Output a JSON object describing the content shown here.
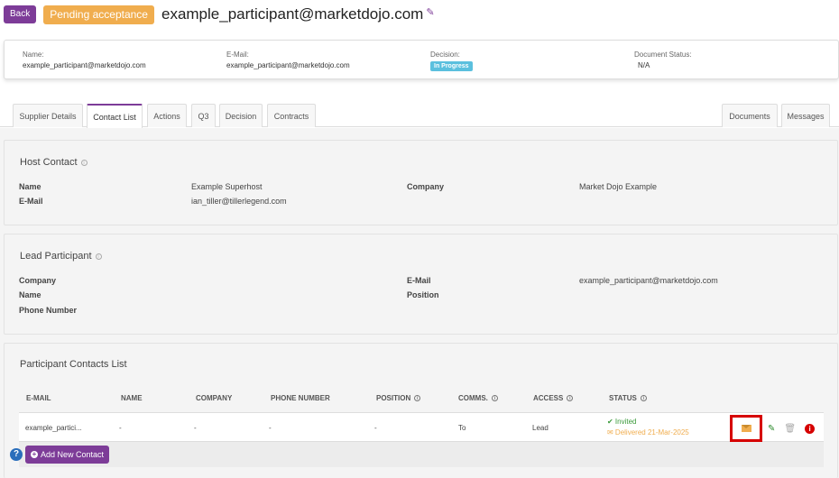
{
  "header": {
    "back_label": "Back",
    "status_badge": "Pending acceptance",
    "title": "example_participant@marketdojo.com"
  },
  "summary": {
    "name_label": "Name:",
    "name_value": "example_participant@marketdojo.com",
    "email_label": "E-Mail:",
    "email_value": "example_participant@marketdojo.com",
    "decision_label": "Decision:",
    "decision_value": "In Progress",
    "doc_status_label": "Document Status:",
    "doc_status_value": "N/A"
  },
  "tabs": {
    "left": [
      "Supplier Details",
      "Contact List",
      "Actions",
      "Q3",
      "Decision",
      "Contracts"
    ],
    "right": [
      "Documents",
      "Messages"
    ],
    "active": "Contact List"
  },
  "host_contact": {
    "title": "Host Contact",
    "name_label": "Name",
    "name_value": "Example Superhost",
    "email_label": "E-Mail",
    "email_value": "ian_tiller@tillerlegend.com",
    "company_label": "Company",
    "company_value": "Market Dojo Example"
  },
  "lead_participant": {
    "title": "Lead Participant",
    "company_label": "Company",
    "name_label": "Name",
    "phone_label": "Phone Number",
    "email_label": "E-Mail",
    "email_value": "example_participant@marketdojo.com",
    "position_label": "Position"
  },
  "participant_contacts": {
    "title": "Participant Contacts List",
    "columns": [
      "E-MAIL",
      "NAME",
      "COMPANY",
      "PHONE NUMBER",
      "POSITION",
      "COMMS.",
      "ACCESS",
      "STATUS"
    ],
    "rows": [
      {
        "email": "example_partici...",
        "name": "-",
        "company": "-",
        "phone": "-",
        "position": "-",
        "comms": "To",
        "access": "Lead",
        "status_invited": "✔ Invited",
        "status_delivered": "✉ Delivered 21-Mar-2025"
      }
    ],
    "add_button": "Add New Contact"
  },
  "icons": {
    "edit_title": "pencil-icon",
    "row_mail": "envelope-icon",
    "row_edit": "pencil-icon",
    "row_delete": "trash-icon",
    "row_info": "info-icon",
    "help": "question-icon"
  },
  "colors": {
    "brand_purple": "#7d3c98",
    "pending_orange": "#f0ad4e",
    "in_progress_blue": "#5bc0de",
    "invited_green": "#3a9a3a",
    "highlight_red": "#d60000"
  }
}
